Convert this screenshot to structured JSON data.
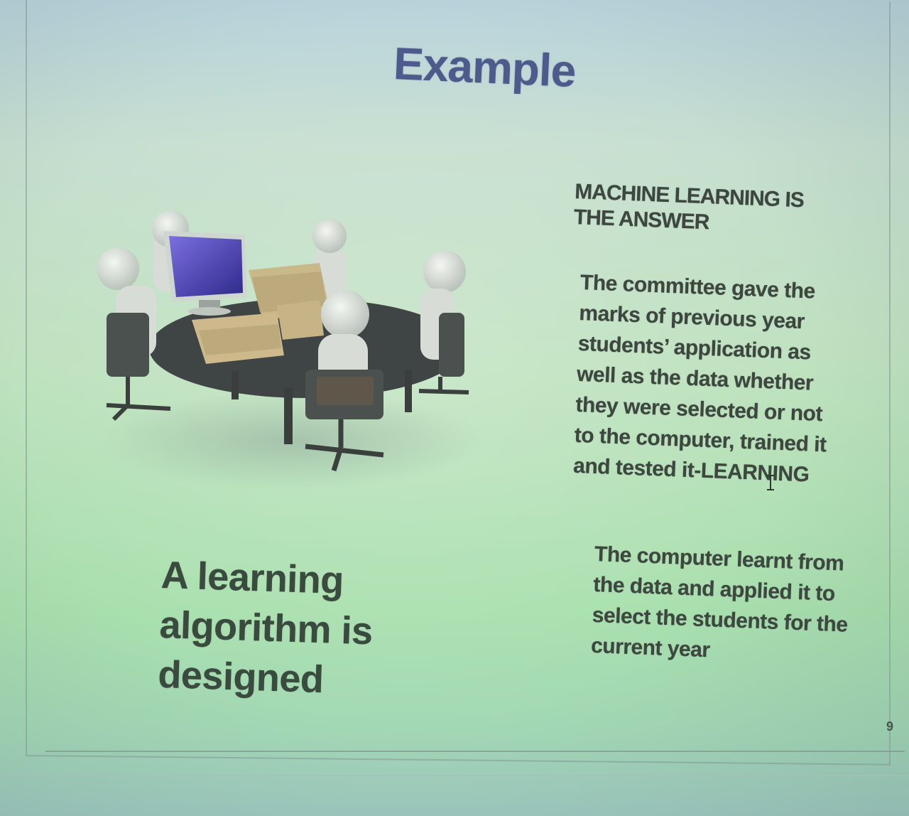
{
  "slide": {
    "title": "Example",
    "heading": "MACHINE LEARNING IS THE ANSWER",
    "paragraph1": "The committee gave the marks of previous year students’ application as well as the data whether they were selected or not to the computer, trained it and tested it-LEARNING",
    "paragraph2": "The computer learnt from the data and applied it to select the students for the current year",
    "big_text": "A learning algorithm is designed",
    "page_number": "9"
  },
  "colors": {
    "title": "#4c5a8c",
    "body_text": "#3d4740",
    "monitor_screen": "#4a3fb0"
  },
  "icons": {
    "illustration": "meeting-table-illustration",
    "cursor": "text-cursor-icon"
  }
}
